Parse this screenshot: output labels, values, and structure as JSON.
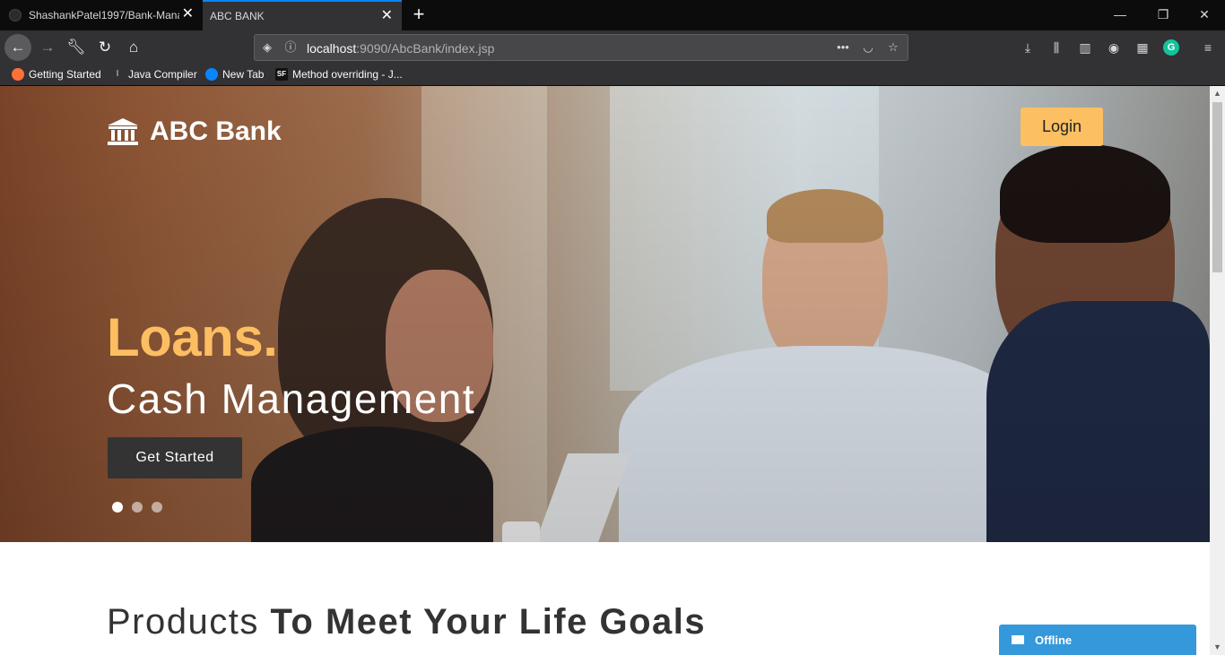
{
  "browser": {
    "tabs": [
      {
        "title": "ShashankPatel1997/Bank-Management",
        "active": false
      },
      {
        "title": "ABC BANK",
        "active": true
      }
    ],
    "url": {
      "host": "localhost",
      "rest": ":9090/AbcBank/index.jsp"
    },
    "bookmarks": [
      {
        "label": "Getting Started",
        "icon": "firefox-icon"
      },
      {
        "label": "Java Compiler",
        "icon": "text-cursor-icon"
      },
      {
        "label": "New Tab",
        "icon": "firefox-icon"
      },
      {
        "label": "Method overriding - J...",
        "icon": "sf-icon"
      }
    ],
    "accent": "#0a84ff"
  },
  "page": {
    "brand": {
      "name": "ABC Bank",
      "icon": "bank-icon"
    },
    "login_label": "Login",
    "hero": {
      "headline": "Loans.",
      "subheadline": "Cash Management",
      "cta_label": "Get Started",
      "slides": 3,
      "active_slide": 1,
      "accent": "#fcc062"
    },
    "section_title": {
      "light": "Products ",
      "bold": "To Meet Your Life Goals"
    },
    "chat": {
      "status": "Offline",
      "color": "#3498db"
    }
  }
}
